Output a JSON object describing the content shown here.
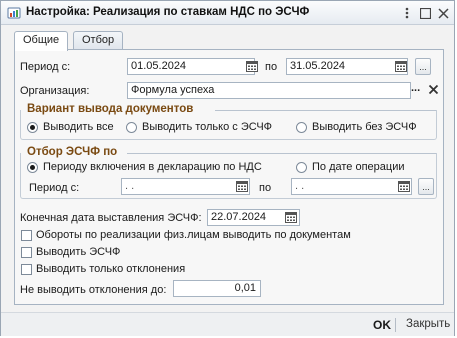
{
  "window": {
    "title": "Настройка: Реализация по ставкам НДС по ЭСЧФ",
    "more_label": "⋮"
  },
  "tabs": [
    {
      "label": "Общие",
      "active": true
    },
    {
      "label": "Отбор",
      "active": false
    }
  ],
  "period": {
    "label": "Период с:",
    "from": "01.05.2024",
    "to_label": "по",
    "to": "31.05.2024",
    "ellipsis_label": "..."
  },
  "organization": {
    "label": "Организация:",
    "value": "Формула успеха",
    "select_label": "..."
  },
  "output_variant": {
    "title": "Вариант вывода документов",
    "options": [
      {
        "label": "Выводить все",
        "selected": true
      },
      {
        "label": "Выводить только с ЭСЧФ",
        "selected": false
      },
      {
        "label": "Выводить без ЭСЧФ",
        "selected": false
      }
    ]
  },
  "esf_filter": {
    "title": "Отбор ЭСЧФ по",
    "options": [
      {
        "label": "Периоду включения в декларацию по НДС",
        "selected": true
      },
      {
        "label": "По дате операции",
        "selected": false
      }
    ],
    "period_label": "Период с:",
    "from": " .  .",
    "to_label": "по",
    "to": " .  .",
    "ellipsis_label": "..."
  },
  "end_date": {
    "label": "Конечная дата выставления ЭСЧФ:",
    "value": "22.07.2024"
  },
  "checks": [
    {
      "label": "Обороты по реализации физ.лицам выводить по документам",
      "checked": false
    },
    {
      "label": "Выводить ЭСЧФ",
      "checked": false
    },
    {
      "label": "Выводить только отклонения",
      "checked": false
    }
  ],
  "deviation": {
    "label": "Не выводить отклонения до:",
    "value": "0,01"
  },
  "footer": {
    "ok_label": "OK",
    "close_label": "Закрыть"
  },
  "colors": {
    "section_title": "#7a4a12",
    "window_border": "#9aa6b4"
  }
}
